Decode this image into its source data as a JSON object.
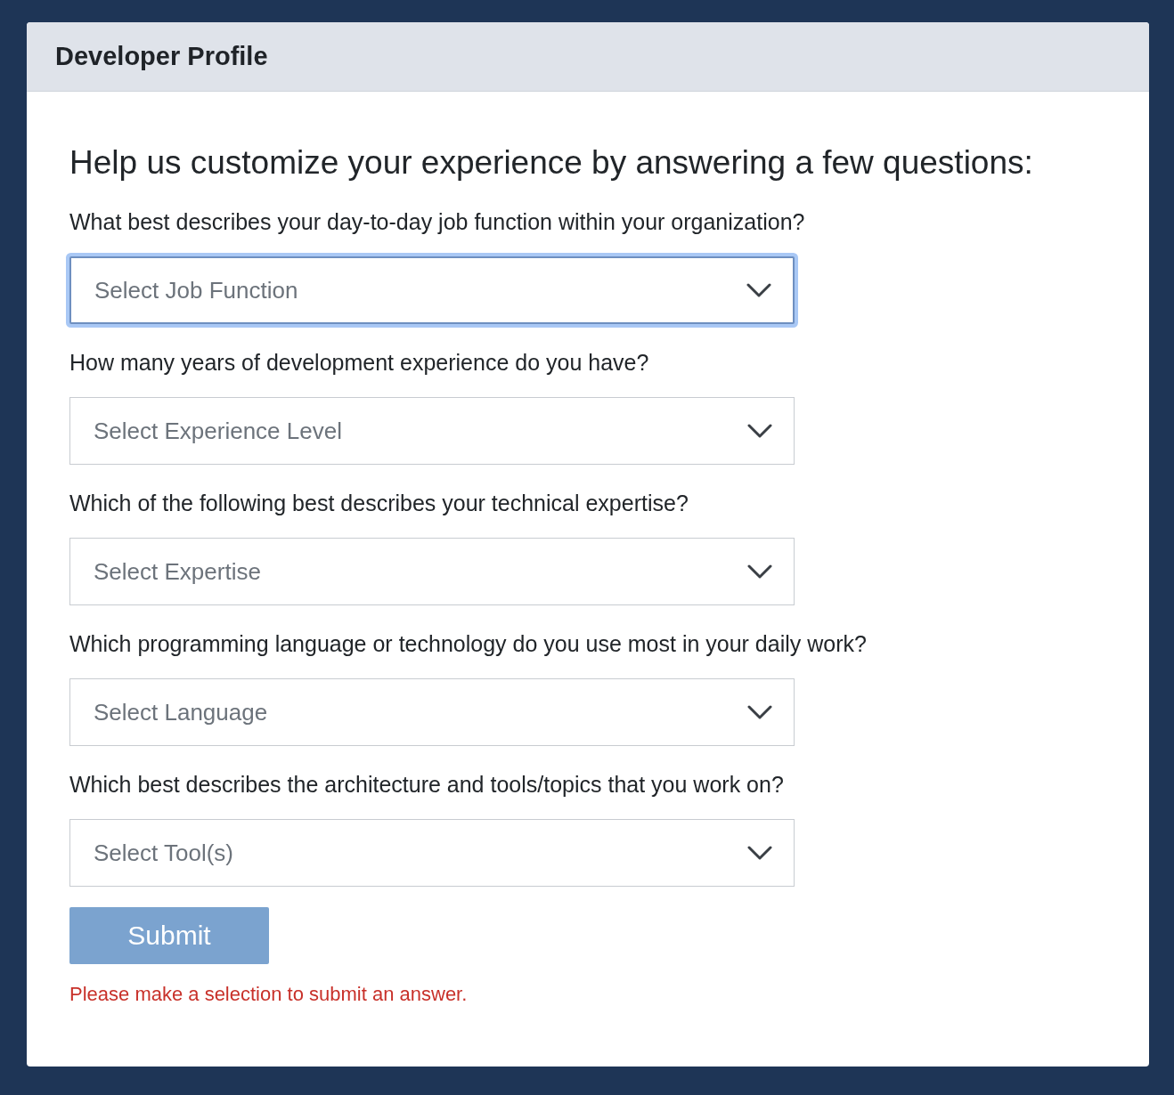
{
  "card": {
    "title": "Developer Profile"
  },
  "heading": "Help us customize your experience by answering a few questions:",
  "questions": [
    {
      "label": "What best describes your day-to-day job function within your organization?",
      "placeholder": "Select Job Function",
      "focused": true
    },
    {
      "label": "How many years of development experience do you have?",
      "placeholder": "Select Experience Level",
      "focused": false
    },
    {
      "label": "Which of the following best describes your technical expertise?",
      "placeholder": "Select Expertise",
      "focused": false
    },
    {
      "label": "Which programming language or technology do you use most in your daily work?",
      "placeholder": "Select Language",
      "focused": false
    },
    {
      "label": "Which best describes the architecture and tools/topics that you work on?",
      "placeholder": "Select Tool(s)",
      "focused": false
    }
  ],
  "submit": {
    "label": "Submit",
    "disabled": true
  },
  "error": "Please make a selection to submit an answer."
}
